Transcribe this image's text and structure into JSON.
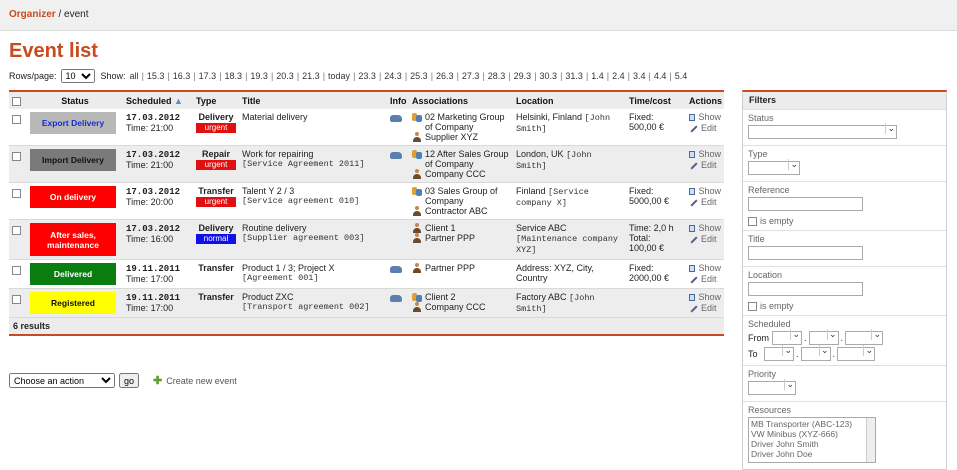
{
  "breadcrumb": {
    "root": "Organizer",
    "separator": " / ",
    "current": "event"
  },
  "page_title": "Event list",
  "rows_per_page": {
    "label": "Rows/page:",
    "value": "10"
  },
  "show": {
    "label": "Show:",
    "links": [
      "all",
      "15.3",
      "16.3",
      "17.3",
      "18.3",
      "19.3",
      "20.3",
      "21.3",
      "today",
      "23.3",
      "24.3",
      "25.3",
      "26.3",
      "27.3",
      "28.3",
      "29.3",
      "30.3",
      "31.3",
      "1.4",
      "2.4",
      "3.4",
      "4.4",
      "5.4"
    ]
  },
  "table": {
    "headers": {
      "status": "Status",
      "scheduled": "Scheduled",
      "type": "Type",
      "title": "Title",
      "info": "Info",
      "associations": "Associations",
      "location": "Location",
      "timecost": "Time/cost",
      "actions": "Actions"
    },
    "rows": [
      {
        "status": "Export Delivery",
        "status_bg": "#b8b8b8",
        "status_color": "#1a2ad0",
        "date": "17.03.2012",
        "time": "Time: 21:00",
        "type": "Delivery",
        "priority": "urgent",
        "priority_bg": "#e01010",
        "title": "Material delivery",
        "ref": "",
        "car": true,
        "assoc": [
          {
            "icon": "group",
            "text": "02 Marketing Group of Company"
          },
          {
            "icon": "person",
            "text": "Supplier XYZ"
          }
        ],
        "location": "Helsinki, Finland",
        "location_ref": "[John Smith]",
        "cost1": "Fixed:",
        "cost2": "500,00 €",
        "cost3": "",
        "show": "Show",
        "edit": "Edit"
      },
      {
        "status": "Import Delivery",
        "status_bg": "#7a7a7a",
        "status_color": "#111111",
        "date": "17.03.2012",
        "time": "Time: 21:00",
        "type": "Repair",
        "priority": "urgent",
        "priority_bg": "#e01010",
        "title": "Work for repairing",
        "ref": "[Service Agreement 2011]",
        "car": true,
        "assoc": [
          {
            "icon": "group",
            "text": "12 After Sales Group of Company"
          },
          {
            "icon": "person",
            "text": "Company CCC"
          }
        ],
        "location": "London, UK",
        "location_ref": "[John Smith]",
        "cost1": "",
        "cost2": "",
        "cost3": "",
        "show": "Show",
        "edit": "Edit"
      },
      {
        "status": "On delivery",
        "status_bg": "#ff0000",
        "status_color": "#ffffff",
        "date": "17.03.2012",
        "time": "Time: 20:00",
        "type": "Transfer",
        "priority": "urgent",
        "priority_bg": "#e01010",
        "title": "Talent Y 2 / 3",
        "ref": "[Service agreement 010]",
        "car": false,
        "assoc": [
          {
            "icon": "group",
            "text": "03 Sales Group of Company"
          },
          {
            "icon": "person",
            "text": "Contractor ABC"
          }
        ],
        "location": "Finland",
        "location_ref": "[Service company X]",
        "cost1": "Fixed:",
        "cost2": "5000,00 €",
        "cost3": "",
        "show": "Show",
        "edit": "Edit"
      },
      {
        "status": "After sales, maintenance",
        "status_bg": "#ff0000",
        "status_color": "#ffffff",
        "date": "17.03.2012",
        "time": "Time: 16:00",
        "type": "Delivery",
        "priority": "normal",
        "priority_bg": "#1010e8",
        "title": "Routine delivery",
        "ref": "[Supplier agreement 003]",
        "car": false,
        "assoc": [
          {
            "icon": "person",
            "text": "Client 1"
          },
          {
            "icon": "person",
            "text": "Partner PPP"
          }
        ],
        "location": "Service ABC",
        "location_ref": "[Maintenance company XYZ]",
        "cost1": "Time: 2,0 h",
        "cost2": "Total:",
        "cost3": "100,00 €",
        "show": "Show",
        "edit": "Edit"
      },
      {
        "status": "Delivered",
        "status_bg": "#0a7d10",
        "status_color": "#ffffff",
        "date": "19.11.2011",
        "time": "Time: 17:00",
        "type": "Transfer",
        "priority": "",
        "priority_bg": "",
        "title": "Product 1 / 3; Project X",
        "ref": "[Agreement 001]",
        "car": true,
        "assoc": [
          {
            "icon": "person",
            "text": "Partner PPP"
          }
        ],
        "location": "Address: XYZ, City, Country",
        "location_ref": "",
        "cost1": "Fixed:",
        "cost2": "2000,00 €",
        "cost3": "",
        "show": "Show",
        "edit": "Edit"
      },
      {
        "status": "Registered",
        "status_bg": "#ffff00",
        "status_color": "#111111",
        "date": "19.11.2011",
        "time": "Time: 17:00",
        "type": "Transfer",
        "priority": "",
        "priority_bg": "",
        "title": "Product ZXC",
        "ref": "[Transport agreement 002]",
        "car": true,
        "assoc": [
          {
            "icon": "group",
            "text": "Client 2"
          },
          {
            "icon": "person",
            "text": "Company CCC"
          }
        ],
        "location": "Factory ABC",
        "location_ref": "[John Smith]",
        "cost1": "",
        "cost2": "",
        "cost3": "",
        "show": "Show",
        "edit": "Edit"
      }
    ],
    "results": "6 results"
  },
  "bottom": {
    "action_select": "Choose an action",
    "go": "go",
    "create": "Create new event"
  },
  "filters": {
    "title": "Filters",
    "status": "Status",
    "type": "Type",
    "reference": "Reference",
    "is_empty": "is empty",
    "title_label": "Title",
    "location": "Location",
    "scheduled": "Scheduled",
    "from": "From",
    "to": "To",
    "priority": "Priority",
    "resources": "Resources",
    "resource_options": [
      "MB Transporter (ABC-123)",
      "VW Minibus (XYZ-666)",
      "Driver John Smith",
      "Driver John Doe"
    ]
  }
}
